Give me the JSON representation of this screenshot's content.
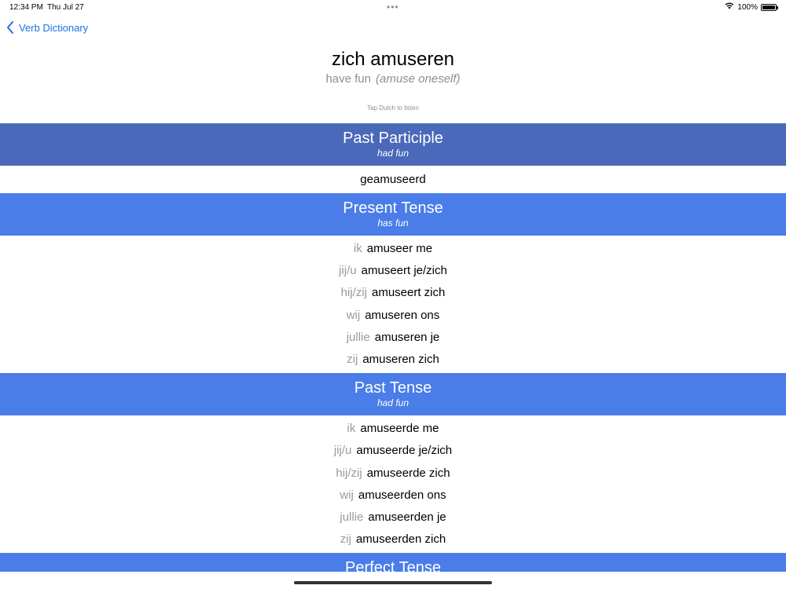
{
  "status": {
    "time": "12:34 PM",
    "date": "Thu Jul 27",
    "battery": "100%",
    "battery_level": 1.0
  },
  "nav": {
    "back_label": "Verb Dictionary"
  },
  "verb": {
    "dutch": "zich amuseren",
    "english": "have fun",
    "english_extra": "(amuse oneself)"
  },
  "hint": "Tap Dutch to listen",
  "sections": {
    "past_participle": {
      "title": "Past Participle",
      "subtitle": "had fun",
      "value": "geamuseerd"
    },
    "present": {
      "title": "Present Tense",
      "subtitle": "has fun",
      "rows": [
        {
          "pronoun": "ik",
          "form": "amuseer me"
        },
        {
          "pronoun": "jij/u",
          "form": "amuseert je/zich"
        },
        {
          "pronoun": "hij/zij",
          "form": "amuseert zich"
        },
        {
          "pronoun": "wij",
          "form": "amuseren ons"
        },
        {
          "pronoun": "jullie",
          "form": "amuseren je"
        },
        {
          "pronoun": "zij",
          "form": "amuseren zich"
        }
      ]
    },
    "past": {
      "title": "Past Tense",
      "subtitle": "had fun",
      "rows": [
        {
          "pronoun": "ik",
          "form": "amuseerde me"
        },
        {
          "pronoun": "jij/u",
          "form": "amuseerde je/zich"
        },
        {
          "pronoun": "hij/zij",
          "form": "amuseerde zich"
        },
        {
          "pronoun": "wij",
          "form": "amuseerden ons"
        },
        {
          "pronoun": "jullie",
          "form": "amuseerden je"
        },
        {
          "pronoun": "zij",
          "form": "amuseerden zich"
        }
      ]
    },
    "perfect": {
      "title": "Perfect Tense"
    }
  },
  "colors": {
    "accent": "#1a73e8",
    "header_dark": "#4a69bb",
    "header_bright": "#4a7de8",
    "pronoun_gray": "#9a9a9a"
  }
}
